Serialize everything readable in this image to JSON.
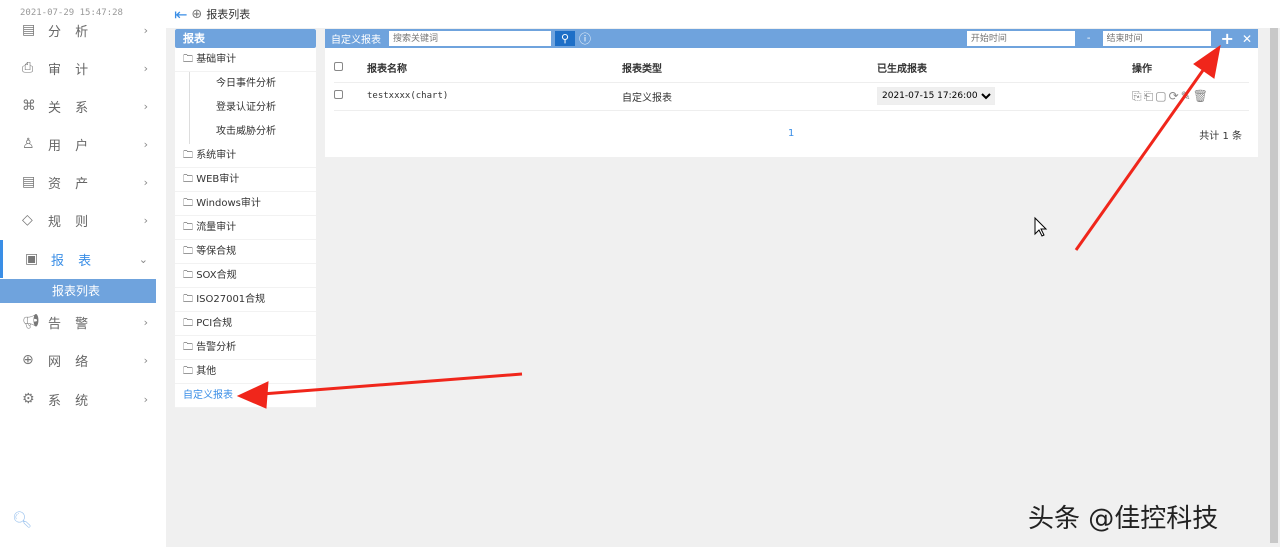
{
  "clock": "2021-07-29 15:47:28",
  "nav": [
    {
      "label": "分 析",
      "icon": "chart-icon"
    },
    {
      "label": "审 计",
      "icon": "audit-icon"
    },
    {
      "label": "关 系",
      "icon": "relation-icon"
    },
    {
      "label": "用 户",
      "icon": "user-icon"
    },
    {
      "label": "资 产",
      "icon": "asset-icon"
    },
    {
      "label": "规 则",
      "icon": "rule-icon"
    },
    {
      "label": "报 表",
      "icon": "report-icon"
    },
    {
      "label": "告 警",
      "icon": "alarm-icon"
    },
    {
      "label": "网 络",
      "icon": "network-icon"
    },
    {
      "label": "系 统",
      "icon": "settings-icon"
    }
  ],
  "nav_sub": "报表列表",
  "breadcrumb": "报表列表",
  "tree": {
    "title": "报表",
    "items": [
      "基础审计",
      "今日事件分析",
      "登录认证分析",
      "攻击威胁分析",
      "系统审计",
      "WEB审计",
      "Windows审计",
      "流量审计",
      "等保合规",
      "SOX合规",
      "ISO27001合规",
      "PCI合规",
      "告警分析",
      "其他",
      "自定义报表"
    ]
  },
  "main": {
    "title": "自定义报表",
    "search_placeholder": "搜索关键词",
    "start_placeholder": "开始时间",
    "dash": "-",
    "end_placeholder": "结束时间",
    "add": "+",
    "close": "✕",
    "columns": [
      "报表名称",
      "报表类型",
      "已生成报表",
      "操作"
    ],
    "rows": [
      {
        "name": "testxxxx(chart)",
        "type": "自定义报表",
        "generated": "2021-07-15 17:26:00"
      }
    ],
    "page": "1",
    "total": "共计 1 条"
  },
  "watermark": "头条 @佳控科技"
}
